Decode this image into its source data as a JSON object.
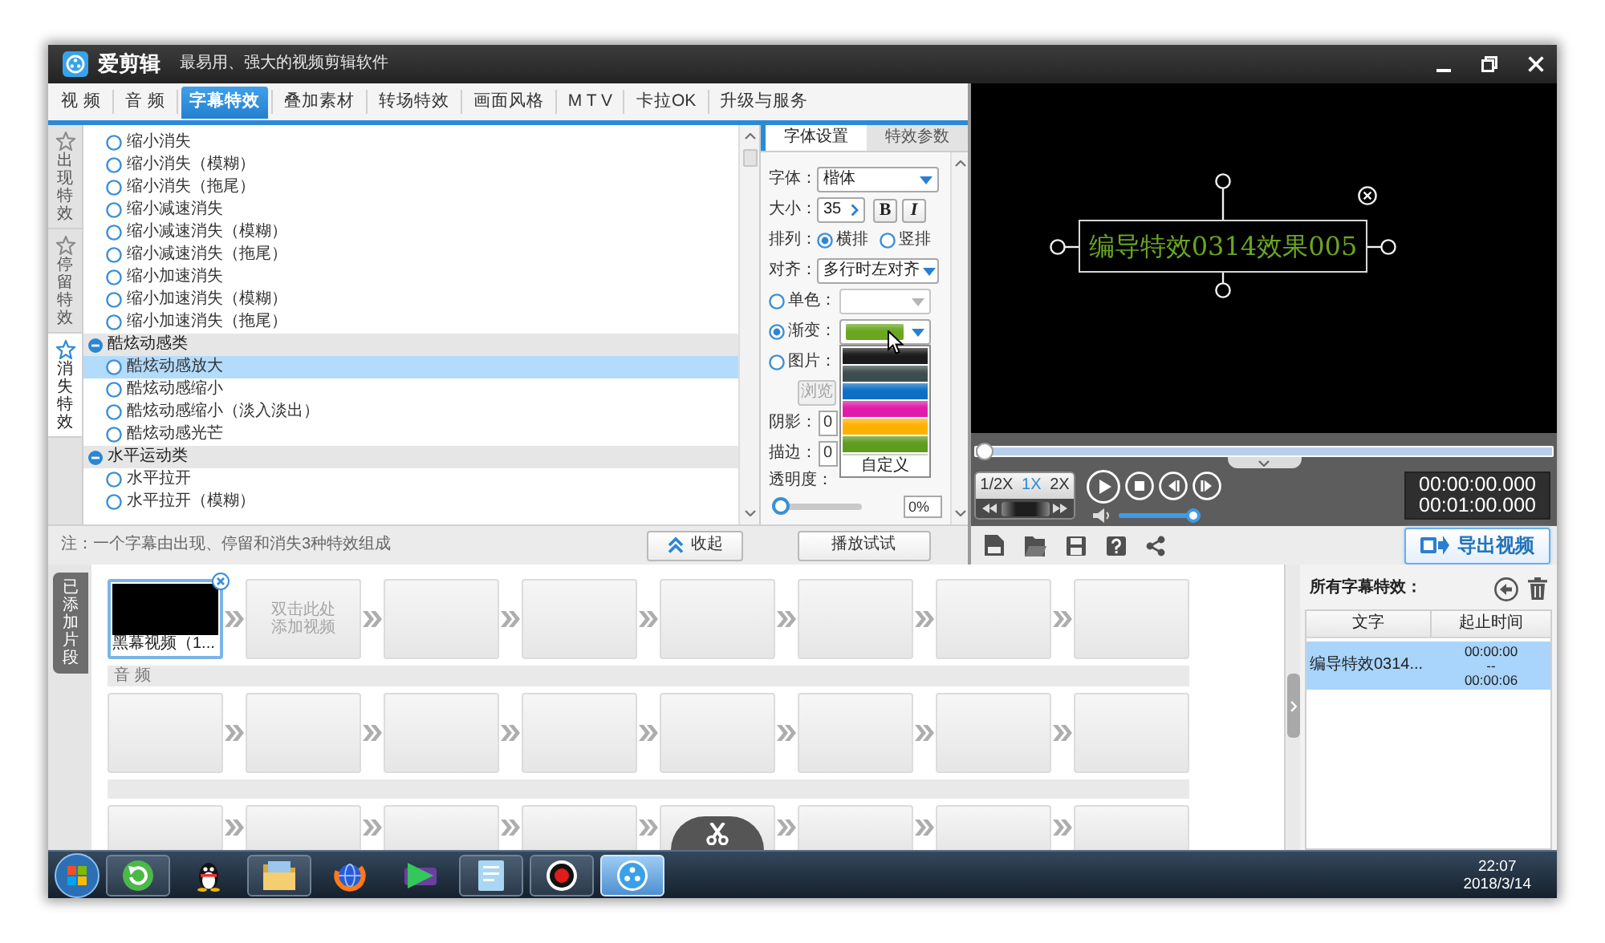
{
  "window": {
    "app_name": "爱剪辑",
    "tagline": "最易用、强大的视频剪辑软件"
  },
  "main_tabs": [
    {
      "label": "视 频",
      "selected": false
    },
    {
      "label": "音 频",
      "selected": false
    },
    {
      "label": "字幕特效",
      "selected": true
    },
    {
      "label": "叠加素材",
      "selected": false
    },
    {
      "label": "转场特效",
      "selected": false
    },
    {
      "label": "画面风格",
      "selected": false
    },
    {
      "label": "M T V",
      "selected": false
    },
    {
      "label": "卡拉OK",
      "selected": false
    },
    {
      "label": "升级与服务",
      "selected": false
    }
  ],
  "effect_tabs": [
    {
      "label": "出现特效",
      "selected": false
    },
    {
      "label": "停留特效",
      "selected": false
    },
    {
      "label": "消失特效",
      "selected": true
    }
  ],
  "effect_groups": [
    {
      "children": [
        {
          "label": "缩小消失",
          "selected": false
        },
        {
          "label": "缩小消失（模糊）",
          "selected": false
        },
        {
          "label": "缩小消失（拖尾）",
          "selected": false
        },
        {
          "label": "缩小减速消失",
          "selected": false
        },
        {
          "label": "缩小减速消失（模糊）",
          "selected": false
        },
        {
          "label": "缩小减速消失（拖尾）",
          "selected": false
        },
        {
          "label": "缩小加速消失",
          "selected": false
        },
        {
          "label": "缩小加速消失（模糊）",
          "selected": false
        },
        {
          "label": "缩小加速消失（拖尾）",
          "selected": false
        }
      ]
    },
    {
      "label": "酷炫动感类",
      "expanded": true,
      "children": [
        {
          "label": "酷炫动感放大",
          "selected": true
        },
        {
          "label": "酷炫动感缩小",
          "selected": false
        },
        {
          "label": "酷炫动感缩小（淡入淡出）",
          "selected": false
        },
        {
          "label": "酷炫动感光芒",
          "selected": false
        }
      ]
    },
    {
      "label": "水平运动类",
      "expanded": true,
      "children": [
        {
          "label": "水平拉开",
          "selected": false
        },
        {
          "label": "水平拉开（模糊）",
          "selected": false
        }
      ]
    }
  ],
  "font_panel": {
    "tabs": [
      {
        "label": "字体设置",
        "selected": true
      },
      {
        "label": "特效参数",
        "selected": false
      }
    ],
    "font": {
      "label": "字体：",
      "value": "楷体"
    },
    "size": {
      "label": "大小：",
      "value": "35"
    },
    "bold_button": "B",
    "italic_button": "I",
    "layout": {
      "label": "排列：",
      "options": [
        {
          "label": "横排",
          "selected": true
        },
        {
          "label": "竖排",
          "selected": false
        }
      ]
    },
    "align": {
      "label": "对齐：",
      "value": "多行时左对齐"
    },
    "fill_modes": [
      {
        "kind": "solid",
        "label": "单色：",
        "selected": false
      },
      {
        "kind": "gradient",
        "label": "渐变：",
        "selected": true
      },
      {
        "kind": "image",
        "label": "图片：",
        "selected": false
      }
    ],
    "gradient": {
      "color": "#6aa61f"
    },
    "gradient_options": [
      {
        "color": "#1b1b1b"
      },
      {
        "color": "#3d4c4f"
      },
      {
        "color": "#0c6fc5"
      },
      {
        "color": "#e01ba9"
      },
      {
        "color": "#ffb000"
      },
      {
        "color": "#5e9c1d"
      }
    ],
    "custom_option": "自定义",
    "browse_button": {
      "label": "浏览",
      "disabled": true
    },
    "shadow": {
      "label": "阴影：",
      "value": "0"
    },
    "outline": {
      "label": "描边：",
      "value": "0"
    },
    "opacity": {
      "label": "透明度：",
      "level": 0,
      "value": "0%"
    },
    "play_button": "播放试试"
  },
  "note": "注：一个字幕由出现、停留和消失3种特效组成",
  "collapse_button": "收起",
  "preview": {
    "caption": "编导特效0314效果005"
  },
  "player": {
    "seek": {
      "level": 0
    },
    "speeds": [
      {
        "label": "1/2X",
        "selected": false
      },
      {
        "label": "1X",
        "selected": true
      },
      {
        "label": "2X",
        "selected": false
      }
    ],
    "volume": {
      "level": 1
    },
    "current_time": "00:00:00.000",
    "total_time": "00:01:00.000"
  },
  "export_button": "导出视频",
  "clips_tab": "已添加片段",
  "tracks": [
    {
      "header": false,
      "slots": [
        {
          "kind": "clip",
          "label": "黑幕视频（1..."
        },
        {
          "kind": "add",
          "label": "双击此处添加视频"
        },
        {
          "kind": "empty"
        },
        {
          "kind": "empty"
        },
        {
          "kind": "empty"
        },
        {
          "kind": "empty"
        },
        {
          "kind": "empty"
        },
        {
          "kind": "empty"
        }
      ]
    },
    {
      "header": true,
      "label": "音 频",
      "slots": [
        {
          "kind": "empty"
        },
        {
          "kind": "empty"
        },
        {
          "kind": "empty"
        },
        {
          "kind": "empty"
        },
        {
          "kind": "empty"
        },
        {
          "kind": "empty"
        },
        {
          "kind": "empty"
        },
        {
          "kind": "empty"
        }
      ]
    },
    {
      "header": true,
      "slots": [
        {
          "kind": "empty"
        },
        {
          "kind": "empty"
        },
        {
          "kind": "empty"
        },
        {
          "kind": "empty"
        },
        {
          "kind": "empty"
        },
        {
          "kind": "empty"
        },
        {
          "kind": "empty"
        },
        {
          "kind": "empty"
        }
      ]
    }
  ],
  "subtitles": {
    "title": "所有字幕特效：",
    "columns": [
      "文字",
      "起止时间"
    ],
    "rows": [
      {
        "text": "编导特效0314...",
        "start": "00:00:00",
        "separator": "--",
        "end": "00:00:06",
        "selected": true
      }
    ]
  },
  "taskbar": {
    "apps": [
      {
        "running": true,
        "selected": false
      },
      {
        "running": false,
        "selected": false
      },
      {
        "running": true,
        "selected": false
      },
      {
        "running": false,
        "selected": false
      },
      {
        "running": false,
        "selected": false
      },
      {
        "running": true,
        "selected": false
      },
      {
        "running": true,
        "selected": false
      },
      {
        "running": true,
        "selected": true
      }
    ],
    "time": "22:07",
    "date": "2018/3/14"
  }
}
